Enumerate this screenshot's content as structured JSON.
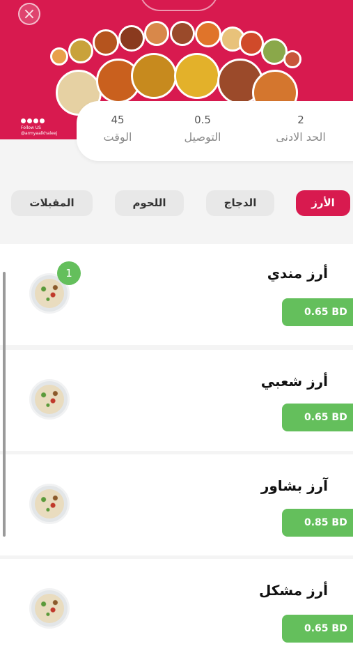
{
  "colors": {
    "brand": "#d81a4f",
    "price_green": "#64bf5c",
    "background": "#f4f4f4"
  },
  "header": {
    "close_icon": "close-icon",
    "social_text": "Follow US",
    "social_handle": "@armyaalkhaleej"
  },
  "stats": [
    {
      "value": "2",
      "label": "الحد الادنى"
    },
    {
      "value": "0.5",
      "label": "التوصيل"
    },
    {
      "value": "45",
      "label": "الوقت"
    }
  ],
  "categories": [
    {
      "label": "الأرز",
      "active": true
    },
    {
      "label": "الدجاج",
      "active": false
    },
    {
      "label": "اللحوم",
      "active": false
    },
    {
      "label": "المقبلات",
      "active": false
    }
  ],
  "items": [
    {
      "name": "أرز مندي",
      "price": "0.65 BD",
      "qty": "1"
    },
    {
      "name": "أرز شعبي",
      "price": "0.65 BD"
    },
    {
      "name": "آرز بشاور",
      "price": "0.85 BD"
    },
    {
      "name": "أرز مشكل",
      "price": "0.65 BD"
    }
  ]
}
